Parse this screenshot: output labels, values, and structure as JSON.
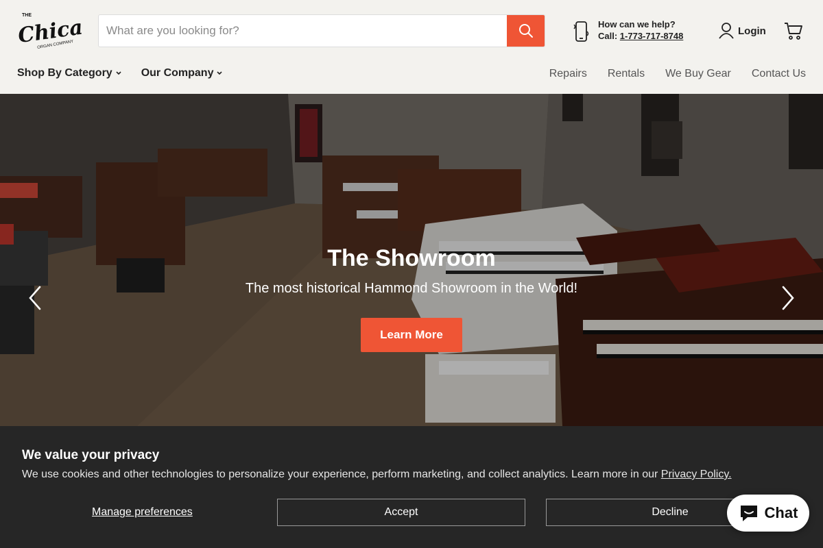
{
  "header": {
    "logo_text": "Chicago",
    "logo_subtext": "THE / ORGAN COMPANY",
    "search": {
      "placeholder": "What are you looking for?",
      "value": ""
    },
    "help": {
      "title": "How can we help?",
      "call_label": "Call:",
      "phone": "1-773-717-8748"
    },
    "login_label": "Login"
  },
  "nav": {
    "left": [
      {
        "label": "Shop By Category"
      },
      {
        "label": "Our Company"
      }
    ],
    "right": [
      {
        "label": "Repairs"
      },
      {
        "label": "Rentals"
      },
      {
        "label": "We Buy Gear"
      },
      {
        "label": "Contact Us"
      }
    ]
  },
  "hero": {
    "title": "The Showroom",
    "subtitle": "The most historical Hammond Showroom in the World!",
    "button_label": "Learn More"
  },
  "cookie": {
    "title": "We value your privacy",
    "text": "We use cookies and other technologies to personalize your experience, perform marketing, and collect analytics. Learn more in our ",
    "link": "Privacy Policy.",
    "manage_label": "Manage preferences",
    "accept_label": "Accept",
    "decline_label": "Decline"
  },
  "chat": {
    "label": "Chat"
  },
  "colors": {
    "accent": "#ef5535",
    "header_bg": "#f3f2ee",
    "banner_bg": "#262626"
  }
}
